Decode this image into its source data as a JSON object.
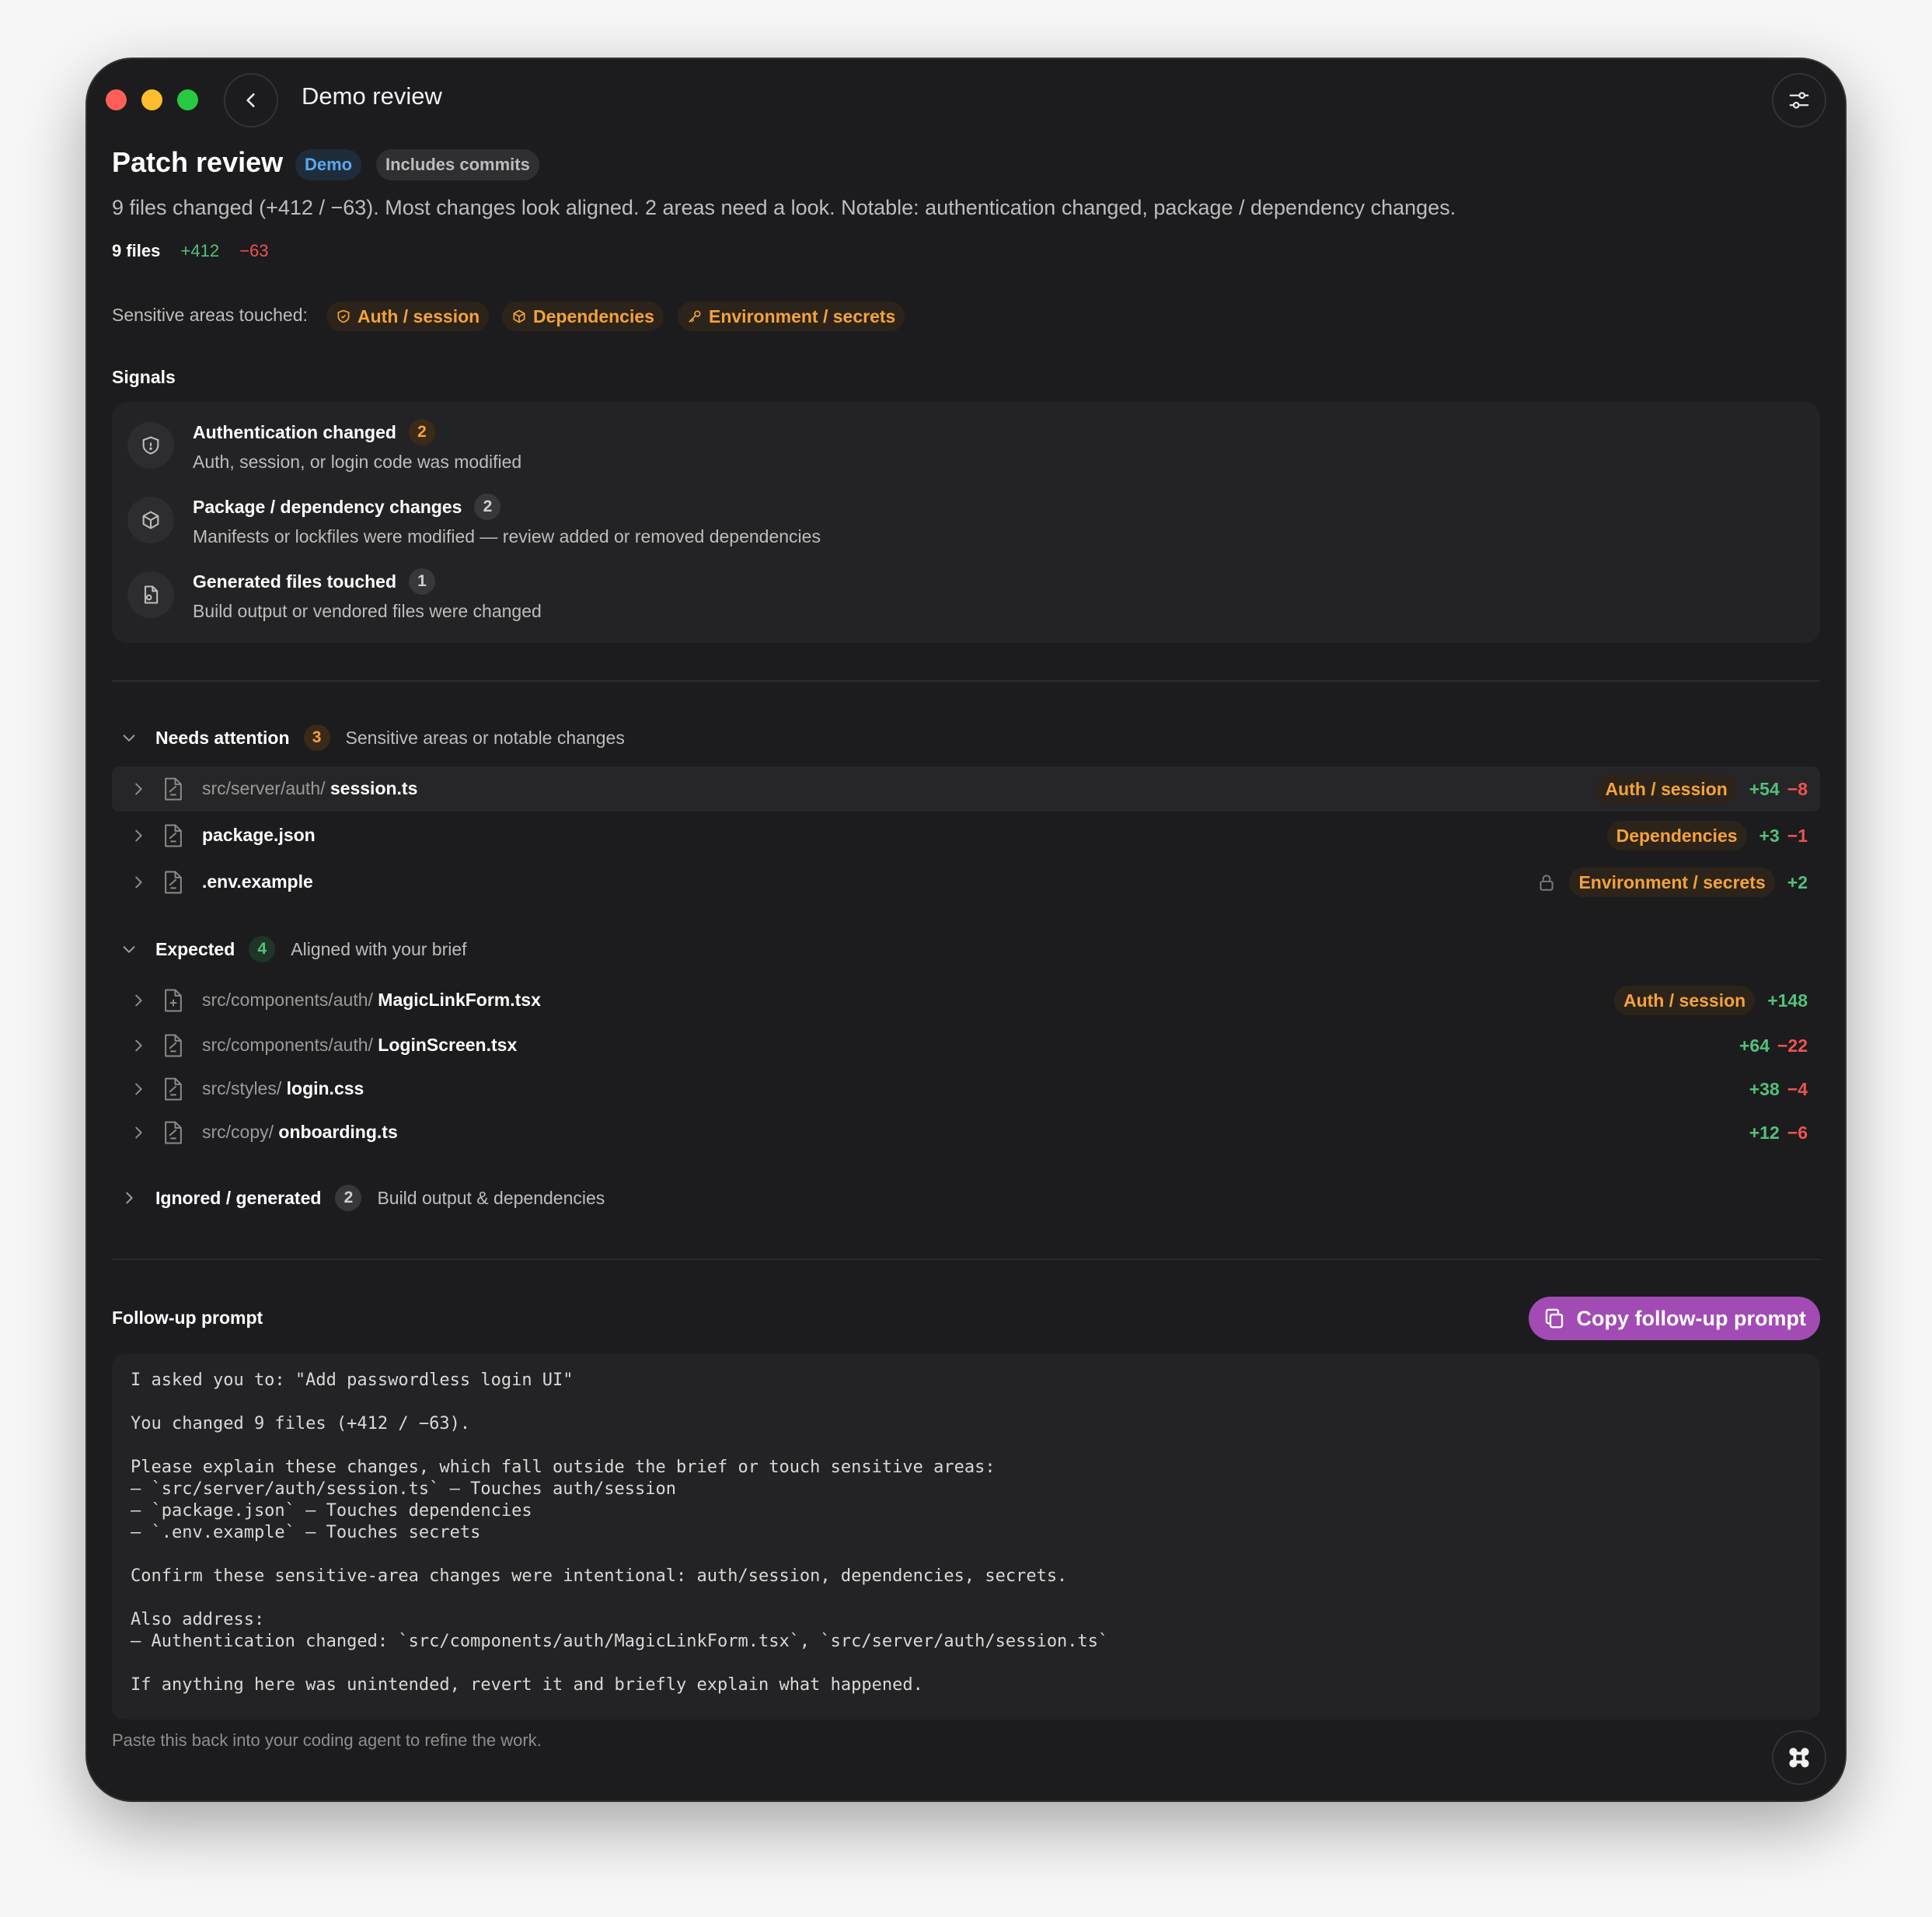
{
  "window": {
    "title": "Demo review",
    "colors": {
      "close": "#ff5f57",
      "minimize": "#febc2e",
      "zoom": "#28c840",
      "accent": "#a24bb4",
      "warning": "#f5a23c",
      "added": "#52c17a",
      "removed": "#ef5350"
    }
  },
  "header": {
    "title": "Patch review",
    "badge_demo": "Demo",
    "badge_commits": "Includes commits",
    "summary": "9 files changed (+412 / −63). Most changes look aligned. 2 areas need a look. Notable: authentication changed, package / dependency changes.",
    "stats": {
      "files": "9 files",
      "added": "+412",
      "removed": "−63"
    }
  },
  "sensitive": {
    "label": "Sensitive areas touched:",
    "tags": [
      {
        "label": "Auth / session",
        "icon": "shield-icon"
      },
      {
        "label": "Dependencies",
        "icon": "package-icon"
      },
      {
        "label": "Environment / secrets",
        "icon": "key-icon"
      }
    ]
  },
  "signals": {
    "heading": "Signals",
    "items": [
      {
        "title": "Authentication changed",
        "count": "2",
        "desc": "Auth, session, or login code was modified",
        "icon": "shield-icon"
      },
      {
        "title": "Package / dependency changes",
        "count": "2",
        "desc": "Manifests or lockfiles were modified — review added or removed dependencies",
        "icon": "package-icon"
      },
      {
        "title": "Generated files touched",
        "count": "1",
        "desc": "Build output or vendored files were changed",
        "icon": "generated-file-icon"
      }
    ]
  },
  "groups": {
    "needs_attention": {
      "name": "Needs attention",
      "count": "3",
      "desc": "Sensitive areas or notable changes",
      "files": [
        {
          "dir": "src/server/auth/",
          "name": "session.ts",
          "tag": "Auth / session",
          "added": "+54",
          "removed": "−8"
        },
        {
          "dir": "",
          "name": "package.json",
          "tag": "Dependencies",
          "added": "+3",
          "removed": "−1"
        },
        {
          "dir": "",
          "name": ".env.example",
          "tag": "Environment / secrets",
          "added": "+2",
          "removed": ""
        }
      ]
    },
    "expected": {
      "name": "Expected",
      "count": "4",
      "desc": "Aligned with your brief",
      "files": [
        {
          "dir": "src/components/auth/",
          "name": "MagicLinkForm.tsx",
          "tag": "Auth / session",
          "added": "+148",
          "removed": ""
        },
        {
          "dir": "src/components/auth/",
          "name": "LoginScreen.tsx",
          "tag": "",
          "added": "+64",
          "removed": "−22"
        },
        {
          "dir": "src/styles/",
          "name": "login.css",
          "tag": "",
          "added": "+38",
          "removed": "−4"
        },
        {
          "dir": "src/copy/",
          "name": "onboarding.ts",
          "tag": "",
          "added": "+12",
          "removed": "−6"
        }
      ]
    },
    "ignored": {
      "name": "Ignored / generated",
      "count": "2",
      "desc": "Build output & dependencies"
    }
  },
  "followup": {
    "heading": "Follow-up prompt",
    "copy_label": "Copy follow-up prompt",
    "prompt": "I asked you to: \"Add passwordless login UI\"\n\nYou changed 9 files (+412 / −63).\n\nPlease explain these changes, which fall outside the brief or touch sensitive areas:\n– `src/server/auth/session.ts` — Touches auth/session\n– `package.json` — Touches dependencies\n– `.env.example` — Touches secrets\n\nConfirm these sensitive-area changes were intentional: auth/session, dependencies, secrets.\n\nAlso address:\n– Authentication changed: `src/components/auth/MagicLinkForm.tsx`, `src/server/auth/session.ts`\n\nIf anything here was unintended, revert it and briefly explain what happened.",
    "note": "Paste this back into your coding agent to refine the work."
  }
}
